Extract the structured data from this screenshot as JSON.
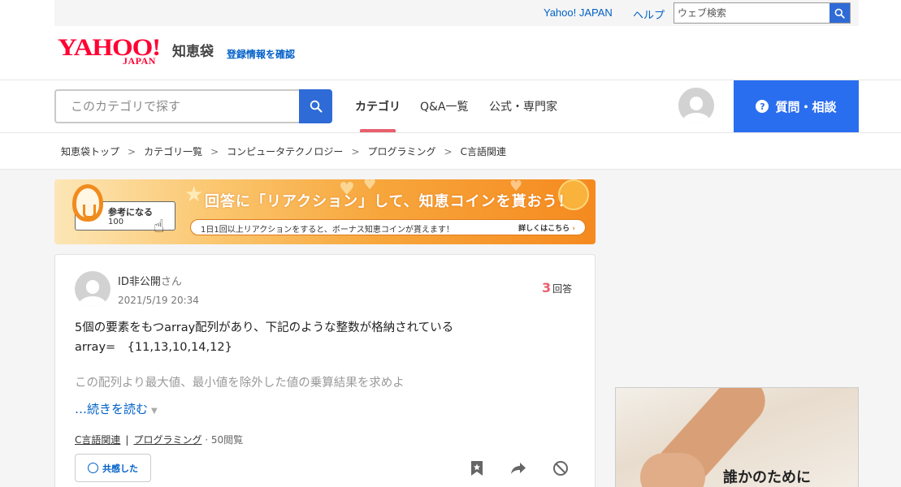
{
  "utility": {
    "yahoo_japan": "Yahoo! JAPAN",
    "help": "ヘルプ",
    "search_placeholder": "ウェブ検索"
  },
  "logo": {
    "yahoo": "YAHOO!",
    "japan": "JAPAN",
    "service": "知恵袋",
    "register_link": "登録情報を確認"
  },
  "nav": {
    "search_placeholder": "このカテゴリで探す",
    "tabs": [
      {
        "label": "カテゴリ",
        "active": true
      },
      {
        "label": "Q&A一覧",
        "active": false
      },
      {
        "label": "公式・専門家",
        "active": false
      }
    ],
    "ask_button": "質問・相談",
    "ask_icon": "?"
  },
  "breadcrumb": [
    "知恵袋トップ",
    "カテゴリ一覧",
    "コンピュータテクノロジー",
    "プログラミング",
    "C言語関連"
  ],
  "banner": {
    "card_label": "参考になる",
    "card_count": "100",
    "title": "回答に「リアクション」して、知恵コインを貰おう！",
    "subtitle": "1日1回以上リアクションをすると、ボーナス知恵コインが貰えます！",
    "more": "詳しくはこちら",
    "accent_color": "#f58a1f"
  },
  "question": {
    "user": "ID非公開",
    "user_suffix": "さん",
    "date": "2021/5/19 20:34",
    "answer_count": "3",
    "answer_label": "回答",
    "body_line1": "5個の要素をもつarray配列があり、下記のような整数が格納されている",
    "body_line2": "array=　{11,13,10,14,12}",
    "body_faded": "この配列より最大値、最小値を除外した値の乗算結果を求めよ",
    "read_more": "…続きを読む",
    "tags": [
      "C言語関連",
      "プログラミング"
    ],
    "views": "· 50閲覧",
    "empathy_button": "共感した"
  },
  "ad": {
    "text": "誰かのために"
  },
  "colors": {
    "link": "#0060c8",
    "primary_blue": "#2a6ef0",
    "active_underline": "#e95f6d",
    "brand_red": "#ff0033"
  }
}
